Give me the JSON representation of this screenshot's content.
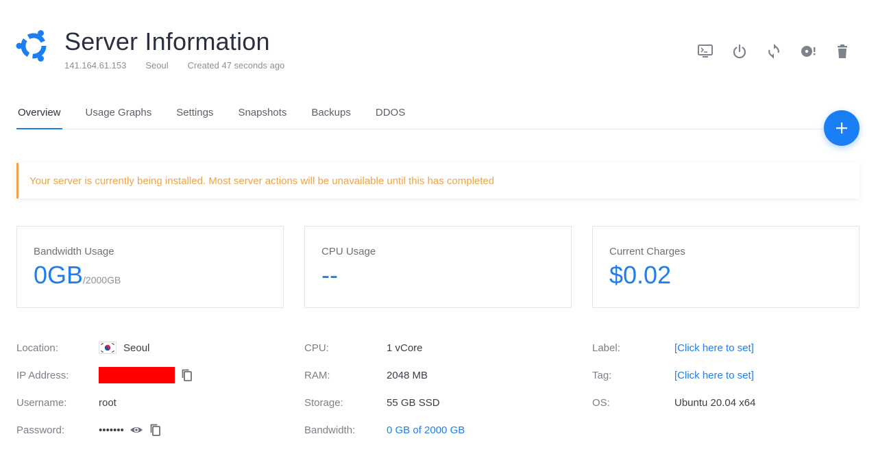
{
  "header": {
    "title": "Server Information",
    "ip": "141.164.61.153",
    "location": "Seoul",
    "created": "Created 47 seconds ago"
  },
  "actions": [
    "console-icon",
    "power-icon",
    "restart-icon",
    "iso-icon",
    "trash-icon"
  ],
  "tabs": [
    {
      "label": "Overview",
      "active": true
    },
    {
      "label": "Usage Graphs"
    },
    {
      "label": "Settings"
    },
    {
      "label": "Snapshots"
    },
    {
      "label": "Backups"
    },
    {
      "label": "DDOS"
    }
  ],
  "alert": {
    "text": "Your server is currently being installed. Most server actions will be unavailable until this has completed"
  },
  "cards": {
    "bandwidth": {
      "label": "Bandwidth Usage",
      "value": "0GB",
      "unit": "/2000GB"
    },
    "cpu": {
      "label": "CPU Usage",
      "value": "--"
    },
    "charges": {
      "label": "Current Charges",
      "value": "$0.02"
    }
  },
  "info": {
    "location": {
      "label": "Location:",
      "value": "Seoul"
    },
    "ip": {
      "label": "IP Address:"
    },
    "username": {
      "label": "Username:",
      "value": "root"
    },
    "password": {
      "label": "Password:",
      "value": "•••••••"
    },
    "cpu": {
      "label": "CPU:",
      "value": "1 vCore"
    },
    "ram": {
      "label": "RAM:",
      "value": "2048 MB"
    },
    "storage": {
      "label": "Storage:",
      "value": "55 GB SSD"
    },
    "bandwidth": {
      "label": "Bandwidth:",
      "value": "0 GB of 2000 GB"
    },
    "label": {
      "label": "Label:",
      "value": "[Click here to set]"
    },
    "tag": {
      "label": "Tag:",
      "value": "[Click here to set]"
    },
    "os": {
      "label": "OS:",
      "value": "Ubuntu 20.04 x64"
    }
  },
  "colors": {
    "accent": "#1e7ef0",
    "warning": "#f0a347",
    "redaction": "#ff0000"
  }
}
